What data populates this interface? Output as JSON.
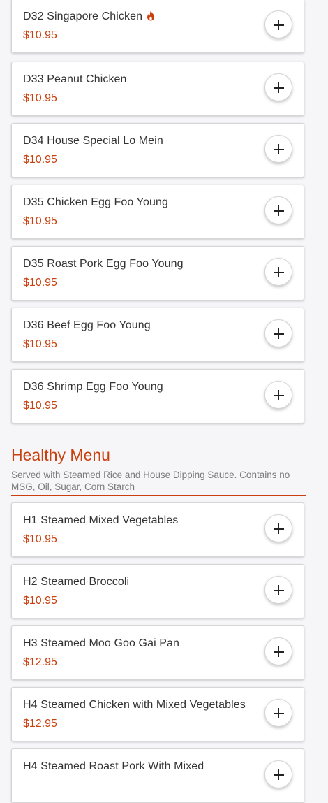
{
  "colors": {
    "accent": "#c9400e",
    "text": "#333333",
    "background": "#f6f6f8"
  },
  "items_top": [
    {
      "name": "D32 Singapore Chicken",
      "price": "$10.95",
      "spicy": true,
      "icon": "fire-icon"
    },
    {
      "name": "D33 Peanut Chicken",
      "price": "$10.95"
    },
    {
      "name": "D34 House Special Lo Mein",
      "price": "$10.95"
    },
    {
      "name": "D35 Chicken Egg Foo Young",
      "price": "$10.95"
    },
    {
      "name": "D35 Roast Pork Egg Foo Young",
      "price": "$10.95"
    },
    {
      "name": "D36 Beef Egg Foo Young",
      "price": "$10.95"
    },
    {
      "name": "D36 Shrimp Egg Foo Young",
      "price": "$10.95"
    }
  ],
  "healthy_menu": {
    "title": "Healthy Menu",
    "description": "Served with Steamed Rice and House Dipping Sauce. Contains no MSG, Oil, Sugar, Corn Starch",
    "items": [
      {
        "name": "H1 Steamed Mixed Vegetables",
        "price": "$10.95"
      },
      {
        "name": "H2 Steamed Broccoli",
        "price": "$10.95"
      },
      {
        "name": "H3 Steamed Moo Goo Gai Pan",
        "price": "$12.95"
      },
      {
        "name": "H4 Steamed Chicken with Mixed Vegetables",
        "price": "$12.95"
      },
      {
        "name": "H4 Steamed Roast Pork With Mixed",
        "price": ""
      }
    ]
  },
  "add_button_icon": "plus-icon"
}
